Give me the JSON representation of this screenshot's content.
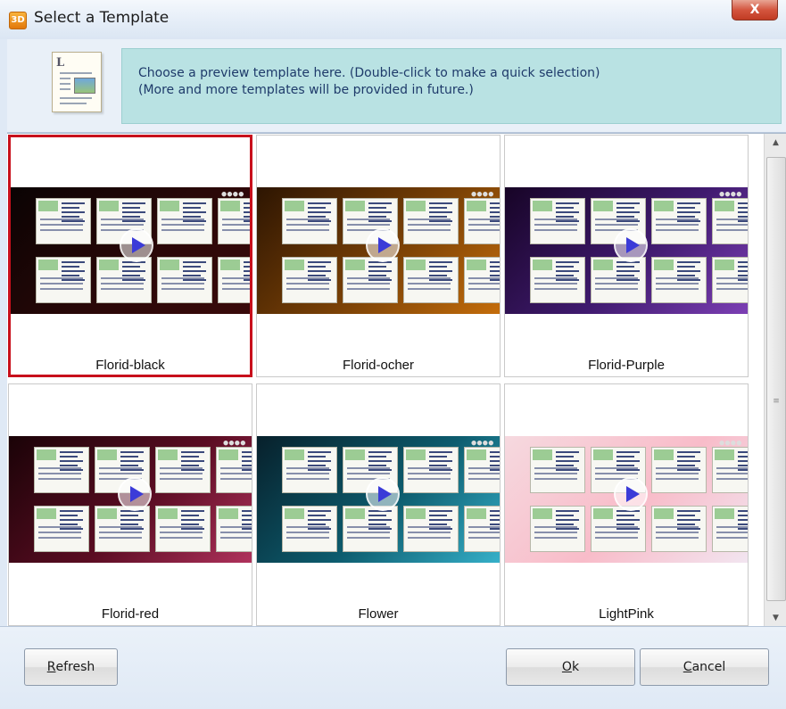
{
  "window": {
    "title": "Select a Template",
    "app_icon_text": "3D",
    "close_glyph": "X"
  },
  "info": {
    "line1": "Choose a preview template here. (Double-click to make a quick selection)",
    "line2": "(More and more templates will be provided in future.)"
  },
  "templates": [
    {
      "label": "Florid-black",
      "selected": true,
      "bg": [
        "#0a0303",
        "#2a0808",
        "#3a0a0a"
      ]
    },
    {
      "label": "Florid-ocher",
      "selected": false,
      "bg": [
        "#2d1502",
        "#7a4106",
        "#c46d0b"
      ]
    },
    {
      "label": "Florid-Purple",
      "selected": false,
      "bg": [
        "#170426",
        "#3f1a6e",
        "#7c3fb4"
      ]
    },
    {
      "label": "Florid-red",
      "selected": false,
      "bg": [
        "#1a0307",
        "#5a0c22",
        "#b0325c"
      ]
    },
    {
      "label": "Flower",
      "selected": false,
      "bg": [
        "#07202b",
        "#0d5c6e",
        "#36b0c9"
      ]
    },
    {
      "label": "LightPink",
      "selected": false,
      "bg": [
        "#f6d9df",
        "#f8bcc9",
        "#f2e5f0"
      ]
    }
  ],
  "buttons": {
    "refresh_prefix": "R",
    "refresh_rest": "efresh",
    "ok_prefix": "O",
    "ok_rest": "k",
    "cancel_prefix": "C",
    "cancel_rest": "ancel"
  },
  "scrollbar": {
    "up": "▲",
    "down": "▼",
    "grip": "≡"
  }
}
